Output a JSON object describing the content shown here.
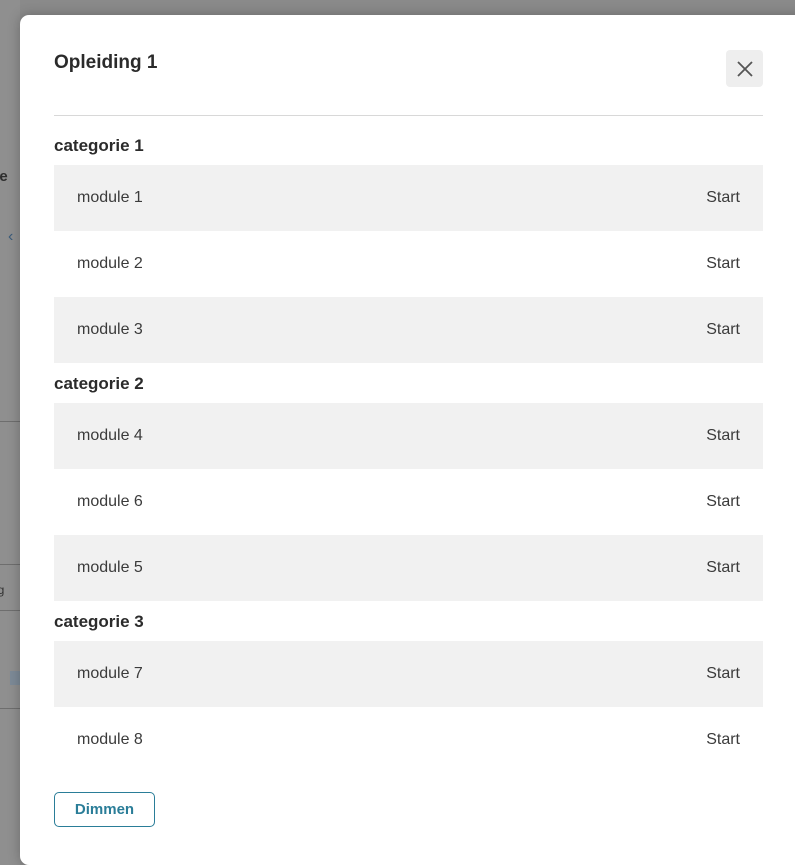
{
  "modal": {
    "title": "Opleiding 1",
    "close_icon": "close-icon",
    "categories": [
      {
        "title": "categorie 1",
        "modules": [
          {
            "name": "module 1",
            "action": "Start"
          },
          {
            "name": "module 2",
            "action": "Start"
          },
          {
            "name": "module 3",
            "action": "Start"
          }
        ]
      },
      {
        "title": "categorie 2",
        "modules": [
          {
            "name": "module 4",
            "action": "Start"
          },
          {
            "name": "module 6",
            "action": "Start"
          },
          {
            "name": "module 5",
            "action": "Start"
          }
        ]
      },
      {
        "title": "categorie 3",
        "modules": [
          {
            "name": "module 7",
            "action": "Start"
          },
          {
            "name": "module 8",
            "action": "Start"
          }
        ]
      }
    ],
    "footer_button": "Dimmen"
  },
  "background_fragments": [
    "ee",
    "e",
    "ng"
  ],
  "colors": {
    "accent": "#2a7d98",
    "row_shade": "#f1f1f1",
    "overlay": "#8a8a8a"
  }
}
